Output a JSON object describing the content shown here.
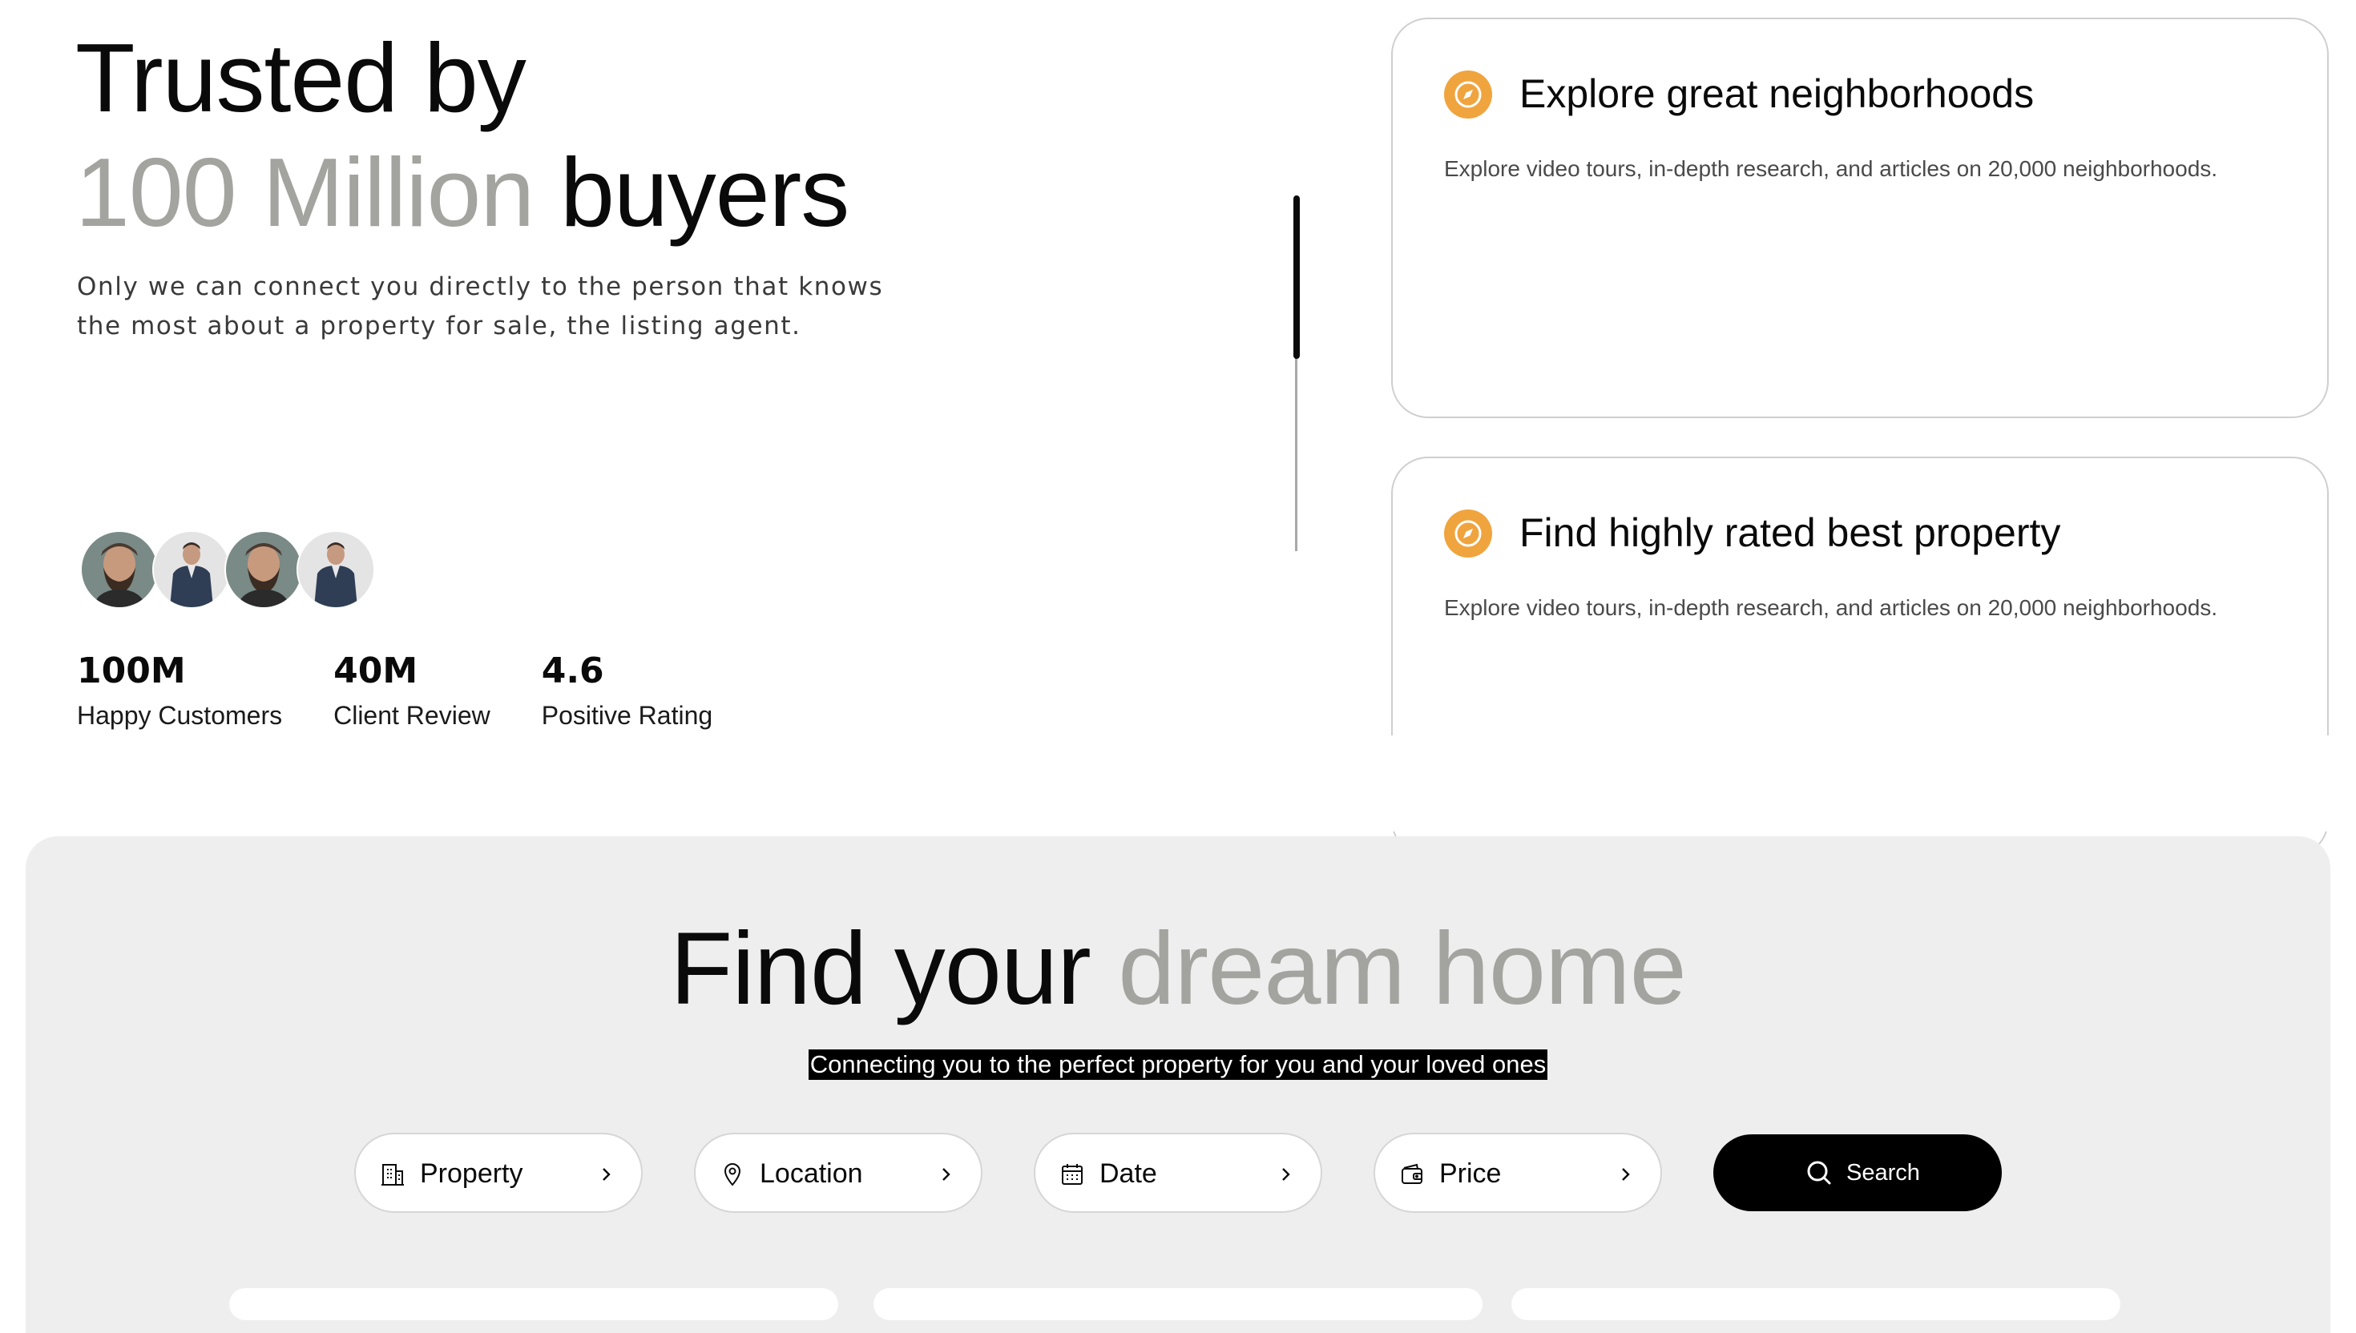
{
  "hero": {
    "title_line1": "Trusted by",
    "title_highlight": "100 Million",
    "title_end": "buyers",
    "subtitle": "Only we can connect you directly to the person that knows the most about a property for sale, the listing agent.",
    "avatars": [
      "bearded-man",
      "man-in-shirt",
      "bearded-man",
      "man-in-shirt"
    ],
    "stats": [
      {
        "value": "100M",
        "label": "Happy Customers"
      },
      {
        "value": "40M",
        "label": "Client Review"
      },
      {
        "value": "4.6",
        "label": "Positive Rating"
      }
    ]
  },
  "features": [
    {
      "icon": "compass-icon",
      "title": "Explore great neighborhoods",
      "text": "Explore video tours, in-depth research, and articles on 20,000 neighborhoods."
    },
    {
      "icon": "compass-icon",
      "title": "Find highly rated best property",
      "text": "Explore video tours, in-depth research, and articles on 20,000 neighborhoods."
    }
  ],
  "search": {
    "title_start": "Find your",
    "title_highlight": "dream home",
    "subtitle": "Connecting you to the perfect property for you and your loved ones",
    "filters": [
      {
        "label": "Property",
        "icon": "building-icon"
      },
      {
        "label": "Location",
        "icon": "map-pin-icon"
      },
      {
        "label": "Date",
        "icon": "calendar-icon"
      },
      {
        "label": "Price",
        "icon": "wallet-icon"
      }
    ],
    "button_label": "Search"
  },
  "colors": {
    "accent": "#f0a43e",
    "muted_text": "#a3a39f",
    "section_bg": "#eeeeee",
    "primary": "#000000"
  }
}
